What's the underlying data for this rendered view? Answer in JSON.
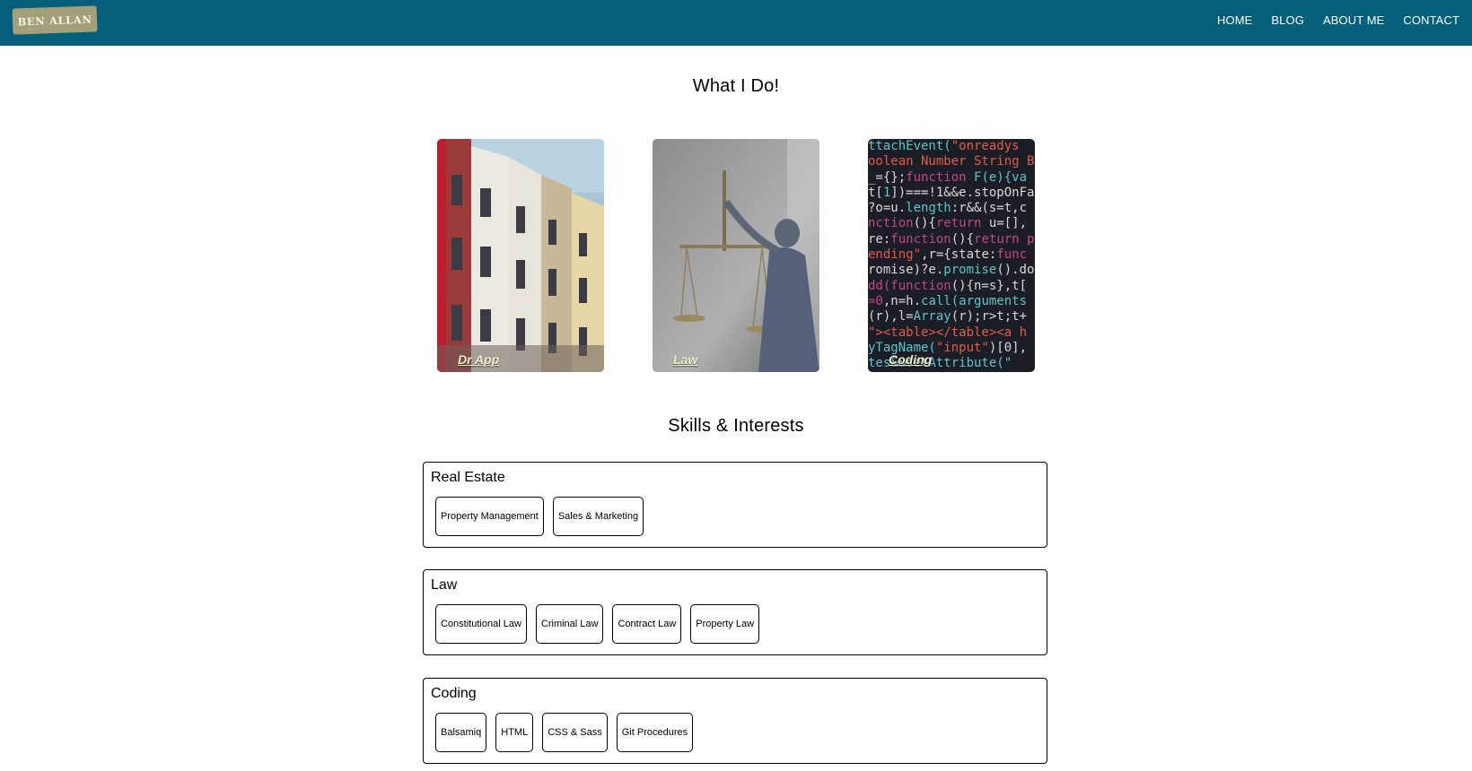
{
  "header": {
    "logo_text": "BEN ALLAN",
    "nav": [
      "HOME",
      "BLOG",
      "ABOUT ME",
      "CONTACT"
    ],
    "bg_color": "#045f7a"
  },
  "what_i_do": {
    "title": "What I Do!",
    "cards": [
      {
        "caption": "Dr App",
        "image": "townhouses-photo"
      },
      {
        "caption": "Law",
        "image": "lady-justice-statue-photo"
      },
      {
        "caption": "Coding",
        "image": "source-code-photo"
      }
    ]
  },
  "skills": {
    "title": "Skills & Interests",
    "groups": [
      {
        "title": "Real Estate",
        "tags": [
          "Property Management",
          "Sales & Marketing"
        ]
      },
      {
        "title": "Law",
        "tags": [
          "Constitutional Law",
          "Criminal Law",
          "Contract Law",
          "Property Law"
        ]
      },
      {
        "title": "Coding",
        "tags": [
          "Balsamiq",
          "HTML",
          "CSS & Sass",
          "Git Procedures"
        ]
      }
    ]
  }
}
